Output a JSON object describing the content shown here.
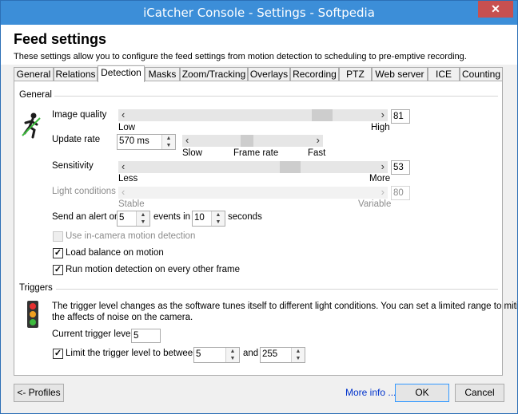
{
  "window": {
    "title": "iCatcher Console - Settings - Softpedia",
    "close_glyph": "✕"
  },
  "header": {
    "title": "Feed settings",
    "description": "These settings allow you to configure the feed settings from motion detection to scheduling to pre-emptive recording."
  },
  "tabs": [
    {
      "label": "General"
    },
    {
      "label": "Relations"
    },
    {
      "label": "Detection",
      "active": true
    },
    {
      "label": "Masks"
    },
    {
      "label": "Zoom/Tracking"
    },
    {
      "label": "Overlays"
    },
    {
      "label": "Recording"
    },
    {
      "label": "PTZ"
    },
    {
      "label": "Web server"
    },
    {
      "label": "ICE"
    },
    {
      "label": "Counting"
    }
  ],
  "general": {
    "section_label": "General",
    "image_quality": {
      "label": "Image quality",
      "value": "81",
      "low": "Low",
      "high": "High",
      "level": 0.81
    },
    "update_rate": {
      "label": "Update rate",
      "value": "570 ms",
      "slow": "Slow",
      "mid": "Frame rate",
      "fast": "Fast",
      "level": 0.45
    },
    "sensitivity": {
      "label": "Sensitivity",
      "value": "53",
      "less": "Less",
      "more": "More",
      "level": 0.67
    },
    "light_conditions": {
      "label": "Light conditions",
      "value": "80",
      "stable": "Stable",
      "variable": "Variable"
    },
    "alert": {
      "prefix": "Send an alert on",
      "events_value": "5",
      "events_label": "events in",
      "seconds_value": "10",
      "seconds_label": "seconds"
    },
    "in_camera": {
      "label": "Use in-camera motion detection",
      "checked": false,
      "disabled": true
    },
    "load_balance": {
      "label": "Load balance on motion",
      "checked": true
    },
    "every_other": {
      "label": "Run motion detection on every other frame",
      "checked": true
    }
  },
  "triggers": {
    "section_label": "Triggers",
    "description_line1": "The trigger level changes as the software tunes itself to different light conditions. You can set a limited range to mitigate",
    "description_line2": "the affects of noise on the camera.",
    "current_label": "Current trigger level",
    "current_value": "5",
    "limit_label": "Limit the trigger level to between",
    "limit_checked": true,
    "limit_from": "5",
    "limit_and": "and",
    "limit_to": "255"
  },
  "footer": {
    "profiles": "<- Profiles",
    "more_info": "More info ...",
    "ok": "OK",
    "cancel": "Cancel"
  },
  "colors": {
    "titlebar": "#3c8ed8",
    "close": "#c75050",
    "link": "#0033cc"
  }
}
